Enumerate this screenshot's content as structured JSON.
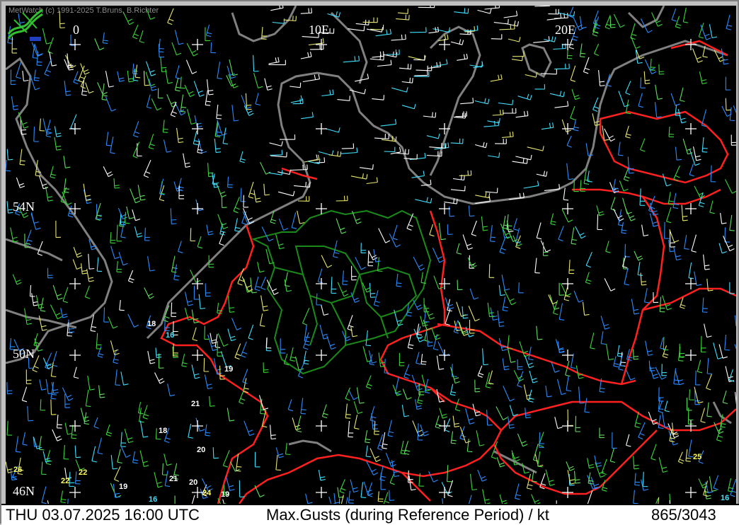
{
  "copyright": "MetWatch  (c) 1991-2025 T.Bruns, B.Richter",
  "grid_labels": {
    "lon_0": "0",
    "lon_10": "10E",
    "lon_20": "20E",
    "lat_54": "54N",
    "lat_50": "50N",
    "lat_46": "46N"
  },
  "station_values": [
    {
      "text": "18",
      "color": "white"
    },
    {
      "text": "16",
      "color": "cyan"
    },
    {
      "text": "19",
      "color": "white"
    },
    {
      "text": "21",
      "color": "white"
    },
    {
      "text": "18",
      "color": "white"
    },
    {
      "text": "20",
      "color": "white"
    },
    {
      "text": "26",
      "color": "yellow"
    },
    {
      "text": "22",
      "color": "yellow"
    },
    {
      "text": "22",
      "color": "yellow"
    },
    {
      "text": "19",
      "color": "white"
    },
    {
      "text": "21",
      "color": "white"
    },
    {
      "text": "20",
      "color": "white"
    },
    {
      "text": "24",
      "color": "yellow"
    },
    {
      "text": "19",
      "color": "white"
    },
    {
      "text": "16",
      "color": "cyan"
    },
    {
      "text": "25",
      "color": "yellow"
    },
    {
      "text": "16",
      "color": "cyan"
    }
  ],
  "status_bar": {
    "datetime": "THU 03.07.2025 16:00 UTC",
    "parameter": "Max.Gusts (during Reference Period) / kt",
    "count": "865/3043"
  },
  "colors": {
    "background": "#000000",
    "coastline": "#808080",
    "border": "#ff2020",
    "state_border": "#1a8a1a",
    "grid_cross": "#ffffff"
  }
}
